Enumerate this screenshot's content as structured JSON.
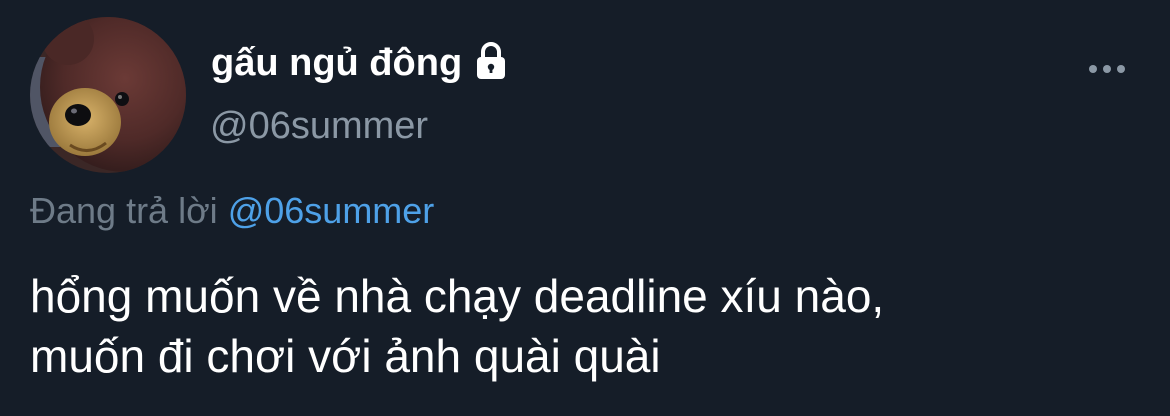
{
  "user": {
    "display_name": "gấu ngủ đông",
    "handle": "@06summer",
    "verified_icon": "lock-icon",
    "avatar_icon": "teddy-bear-avatar"
  },
  "reply": {
    "prefix": "Đang trả lời",
    "handle": "@06summer"
  },
  "tweet": {
    "lines": [
      "hổng muốn về nhà chạy deadline xíu nào,",
      "muốn đi chơi với ảnh quài quài"
    ]
  },
  "menu": {
    "icon": "more-options-icon"
  },
  "colors": {
    "background": "#151d28",
    "primary_text": "#ffffff",
    "secondary_text": "#8b98a5",
    "link": "#4ea1e8"
  }
}
